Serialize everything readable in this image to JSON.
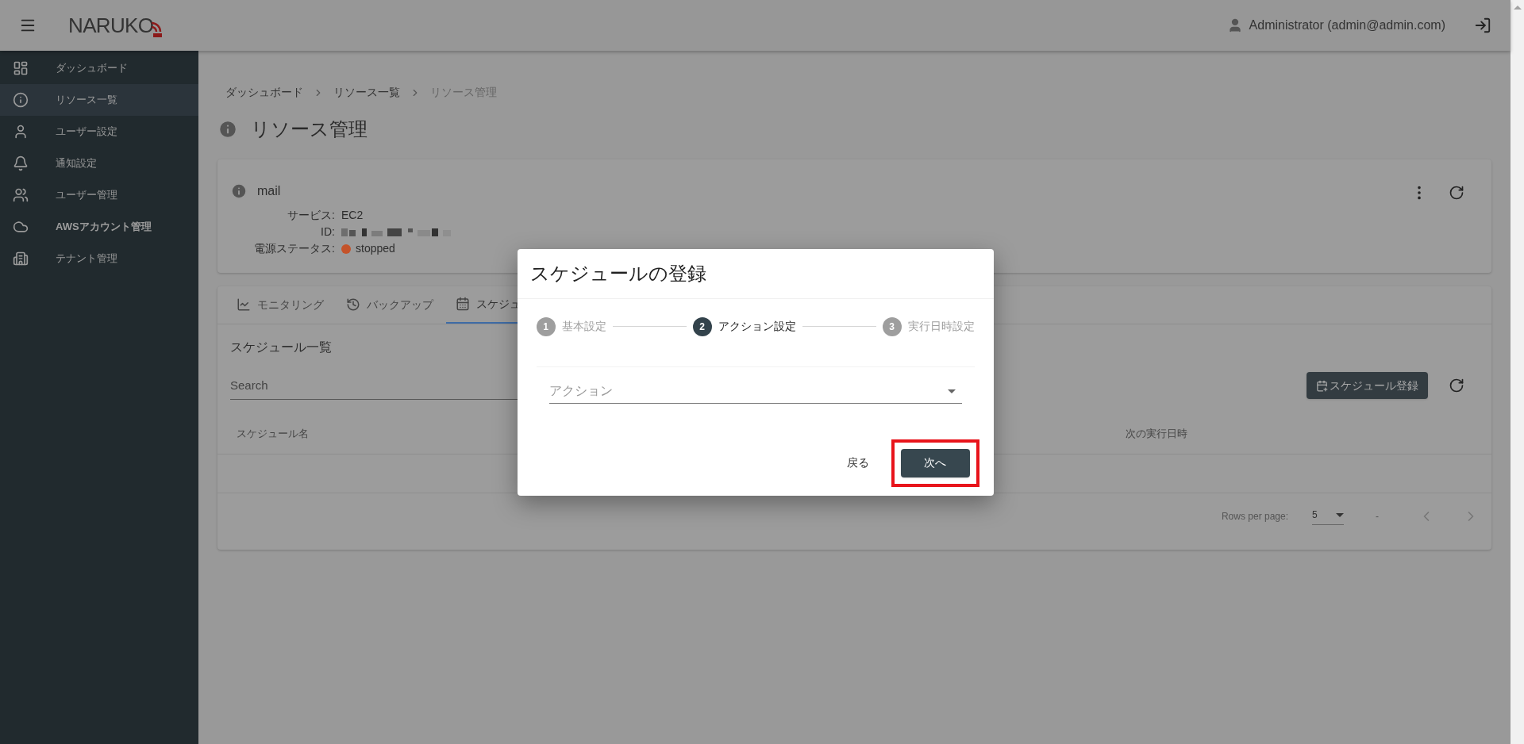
{
  "header": {
    "logo": "NARUKO",
    "user": "Administrator (admin@admin.com)"
  },
  "sidebar": {
    "items": [
      {
        "label": "ダッシュボード",
        "selected": false
      },
      {
        "label": "リソース一覧",
        "selected": true
      },
      {
        "label": "ユーザー設定",
        "selected": false
      },
      {
        "label": "通知設定",
        "selected": false
      },
      {
        "label": "ユーザー管理",
        "selected": false
      },
      {
        "label": "AWSアカウント管理",
        "selected": false
      },
      {
        "label": "テナント管理",
        "selected": false
      }
    ]
  },
  "breadcrumb": [
    "ダッシュボード",
    "リソース一覧",
    "リソース管理"
  ],
  "page_title": "リソース管理",
  "resource": {
    "name": "mail",
    "fields": [
      {
        "label": "サービス:",
        "kind": "text",
        "value": "EC2"
      },
      {
        "label": "ID:",
        "kind": "redacted"
      },
      {
        "label": "電源ステータス:",
        "kind": "status",
        "value": "stopped",
        "color": "#c4532a"
      }
    ]
  },
  "tabs": [
    {
      "label": "モニタリング",
      "selected": false
    },
    {
      "label": "バックアップ",
      "selected": false
    },
    {
      "label": "スケジュ",
      "selected": true
    }
  ],
  "schedule": {
    "title": "スケジュール一覧",
    "search": {
      "placeholder": "Search"
    },
    "add_button": "スケジュール登録",
    "columns": [
      "スケジュール名",
      "次の実行日時"
    ],
    "pagination": {
      "rows_label": "Rows per page:",
      "rows_value": "5",
      "range": "-"
    }
  },
  "dialog": {
    "title": "スケジュールの登録",
    "steps": [
      {
        "number": "1",
        "label": "基本設定",
        "active": false
      },
      {
        "number": "2",
        "label": "アクション設定",
        "active": true
      },
      {
        "number": "3",
        "label": "実行日時設定",
        "active": false
      }
    ],
    "select": {
      "placeholder": "アクション"
    },
    "back_button": "戻る",
    "next_button": "次へ",
    "next_highlighted": true
  }
}
